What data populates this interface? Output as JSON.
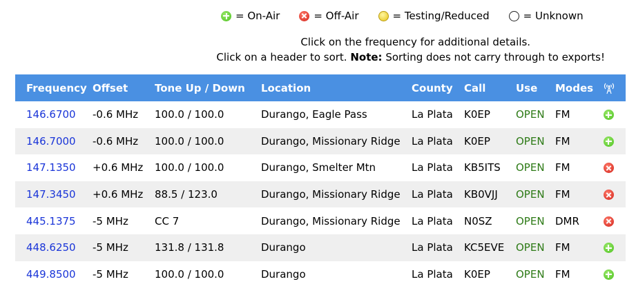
{
  "legend": [
    {
      "status": "on",
      "icon": "on-air-icon",
      "label": "= On-Air"
    },
    {
      "status": "off",
      "icon": "off-air-icon",
      "label": "= Off-Air"
    },
    {
      "status": "test",
      "icon": "testing-reduced-icon",
      "label": "= Testing/Reduced"
    },
    {
      "status": "unknown",
      "icon": "unknown-icon",
      "label": "= Unknown"
    }
  ],
  "notes": {
    "line1": "Click on the frequency for additional details.",
    "line2_prefix": "Click on a header to sort. ",
    "line2_bold": "Note:",
    "line2_suffix": " Sorting does not carry through to exports!"
  },
  "table": {
    "headers": [
      "Frequency",
      "Offset",
      "Tone Up / Down",
      "Location",
      "County",
      "Call",
      "Use",
      "Modes"
    ],
    "status_header_icon": "antenna-icon",
    "rows": [
      {
        "frequency": "146.6700",
        "offset": "-0.6 MHz",
        "tone": "100.0 / 100.0",
        "location": "Durango, Eagle Pass",
        "county": "La Plata",
        "call": "K0EP",
        "use": "OPEN",
        "modes": "FM",
        "status": "on"
      },
      {
        "frequency": "146.7000",
        "offset": "-0.6 MHz",
        "tone": "100.0 / 100.0",
        "location": "Durango, Missionary Ridge",
        "county": "La Plata",
        "call": "K0EP",
        "use": "OPEN",
        "modes": "FM",
        "status": "on"
      },
      {
        "frequency": "147.1350",
        "offset": "+0.6 MHz",
        "tone": "100.0 / 100.0",
        "location": "Durango, Smelter Mtn",
        "county": "La Plata",
        "call": "KB5ITS",
        "use": "OPEN",
        "modes": "FM",
        "status": "off"
      },
      {
        "frequency": "147.3450",
        "offset": "+0.6 MHz",
        "tone": "88.5 / 123.0",
        "location": "Durango, Missionary Ridge",
        "county": "La Plata",
        "call": "KB0VJJ",
        "use": "OPEN",
        "modes": "FM",
        "status": "off"
      },
      {
        "frequency": "445.1375",
        "offset": "-5 MHz",
        "tone": "CC 7",
        "location": "Durango, Missionary Ridge",
        "county": "La Plata",
        "call": "N0SZ",
        "use": "OPEN",
        "modes": "DMR",
        "status": "off"
      },
      {
        "frequency": "448.6250",
        "offset": "-5 MHz",
        "tone": "131.8 / 131.8",
        "location": "Durango",
        "county": "La Plata",
        "call": "KC5EVE",
        "use": "OPEN",
        "modes": "FM",
        "status": "on"
      },
      {
        "frequency": "449.8500",
        "offset": "-5 MHz",
        "tone": "100.0 / 100.0",
        "location": "Durango",
        "county": "La Plata",
        "call": "K0EP",
        "use": "OPEN",
        "modes": "FM",
        "status": "on"
      }
    ]
  },
  "colors": {
    "header_bg": "#4a90e2",
    "link": "#1a35d8",
    "use_open": "#2d7a16",
    "row_alt": "#efefef"
  }
}
